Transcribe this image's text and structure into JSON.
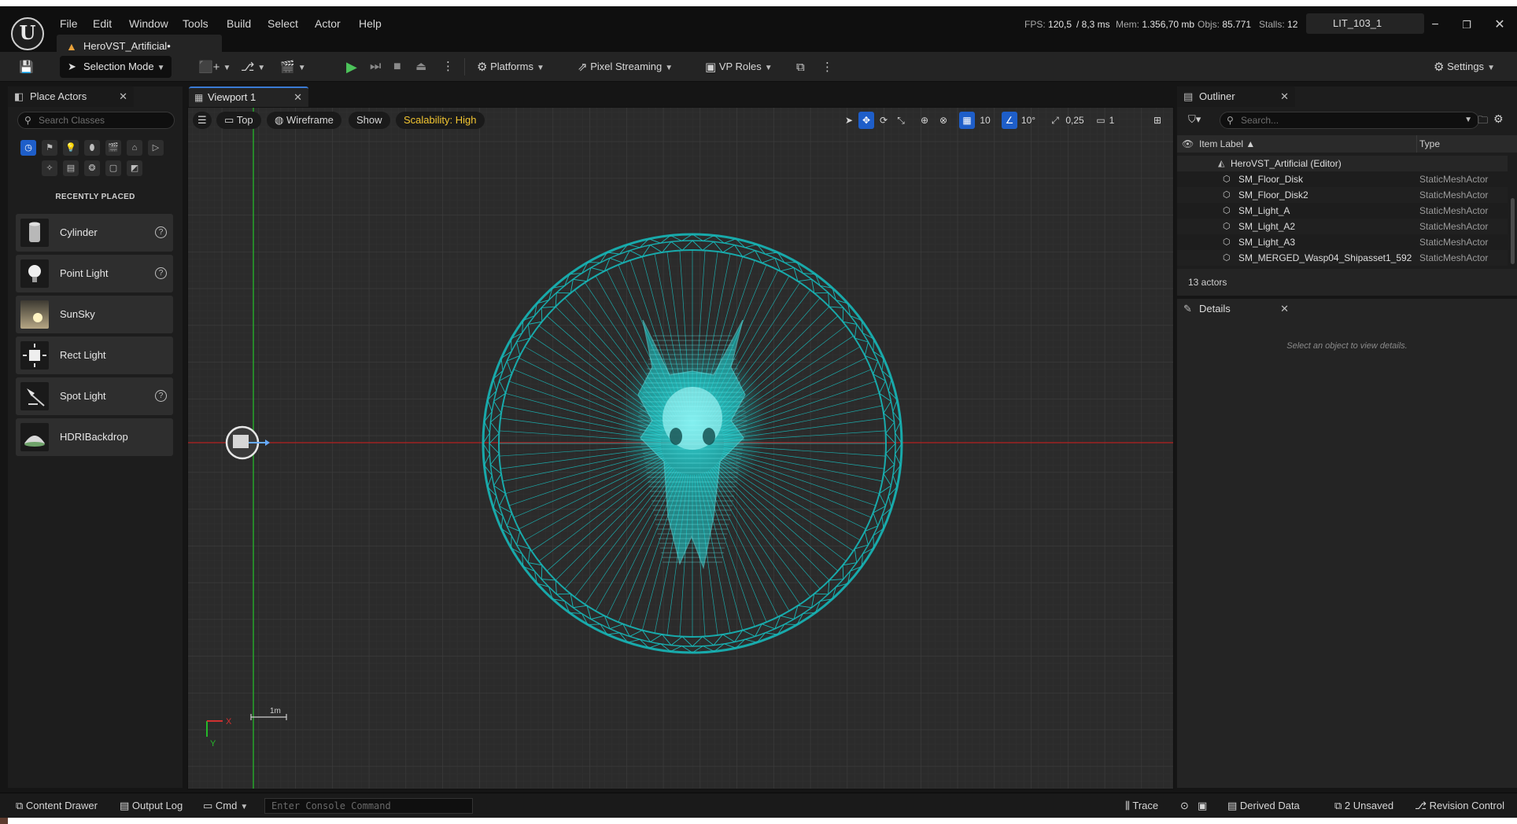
{
  "menu": [
    "File",
    "Edit",
    "Window",
    "Tools",
    "Build",
    "Select",
    "Actor",
    "Help"
  ],
  "document_tab": "HeroVST_Artificial•",
  "stats": {
    "fps_label": "FPS:",
    "fps": "120,5",
    "ms": "/ 8,3 ms",
    "mem_label": "Mem:",
    "mem": "1.356,70 mb",
    "objs_label": "Objs:",
    "objs": "85.771",
    "stalls_label": "Stalls:",
    "stalls": "12"
  },
  "project_name": "LIT_103_1",
  "toolbar": {
    "selection_mode": "Selection Mode",
    "platforms": "Platforms",
    "pixel_streaming": "Pixel Streaming",
    "vp_roles": "VP Roles",
    "settings": "Settings"
  },
  "place_actors": {
    "tab": "Place Actors",
    "search_placeholder": "Search Classes",
    "recent_title": "RECENTLY PLACED",
    "items": [
      {
        "label": "Cylinder",
        "help": true
      },
      {
        "label": "Point Light",
        "help": true
      },
      {
        "label": "SunSky",
        "help": false
      },
      {
        "label": "Rect Light",
        "help": false
      },
      {
        "label": "Spot Light",
        "help": true
      },
      {
        "label": "HDRIBackdrop",
        "help": false
      }
    ]
  },
  "viewport": {
    "tab": "Viewport 1",
    "view": "Top",
    "mode": "Wireframe",
    "show": "Show",
    "scalability": "Scalability: High",
    "grid_snap": "10",
    "rot_snap": "10°",
    "scale_snap": "0,25",
    "camera_speed": "1",
    "scale_label": "1m",
    "axis_x": "X",
    "axis_y": "Y"
  },
  "outliner": {
    "tab": "Outliner",
    "search_placeholder": "Search...",
    "col_label": "Item Label ▲",
    "col_type": "Type",
    "root": "HeroVST_Artificial (Editor)",
    "rows": [
      {
        "name": "SM_Floor_Disk",
        "type": "StaticMeshActor"
      },
      {
        "name": "SM_Floor_Disk2",
        "type": "StaticMeshActor"
      },
      {
        "name": "SM_Light_A",
        "type": "StaticMeshActor"
      },
      {
        "name": "SM_Light_A2",
        "type": "StaticMeshActor"
      },
      {
        "name": "SM_Light_A3",
        "type": "StaticMeshActor"
      },
      {
        "name": "SM_MERGED_Wasp04_Shipasset1_592",
        "type": "StaticMeshActor"
      }
    ],
    "count": "13 actors"
  },
  "details": {
    "tab": "Details",
    "empty": "Select an object to view details."
  },
  "statusbar": {
    "content_drawer": "Content Drawer",
    "output_log": "Output Log",
    "cmd": "Cmd",
    "console_placeholder": "Enter Console Command",
    "trace": "Trace",
    "derived_data": "Derived Data",
    "unsaved": "2 Unsaved",
    "revision_control": "Revision Control"
  },
  "colors": {
    "accent": "#1e5ec9",
    "wireframe": "#1fc7c7",
    "scalability": "#f2c531",
    "warning": "#e9a23b"
  }
}
